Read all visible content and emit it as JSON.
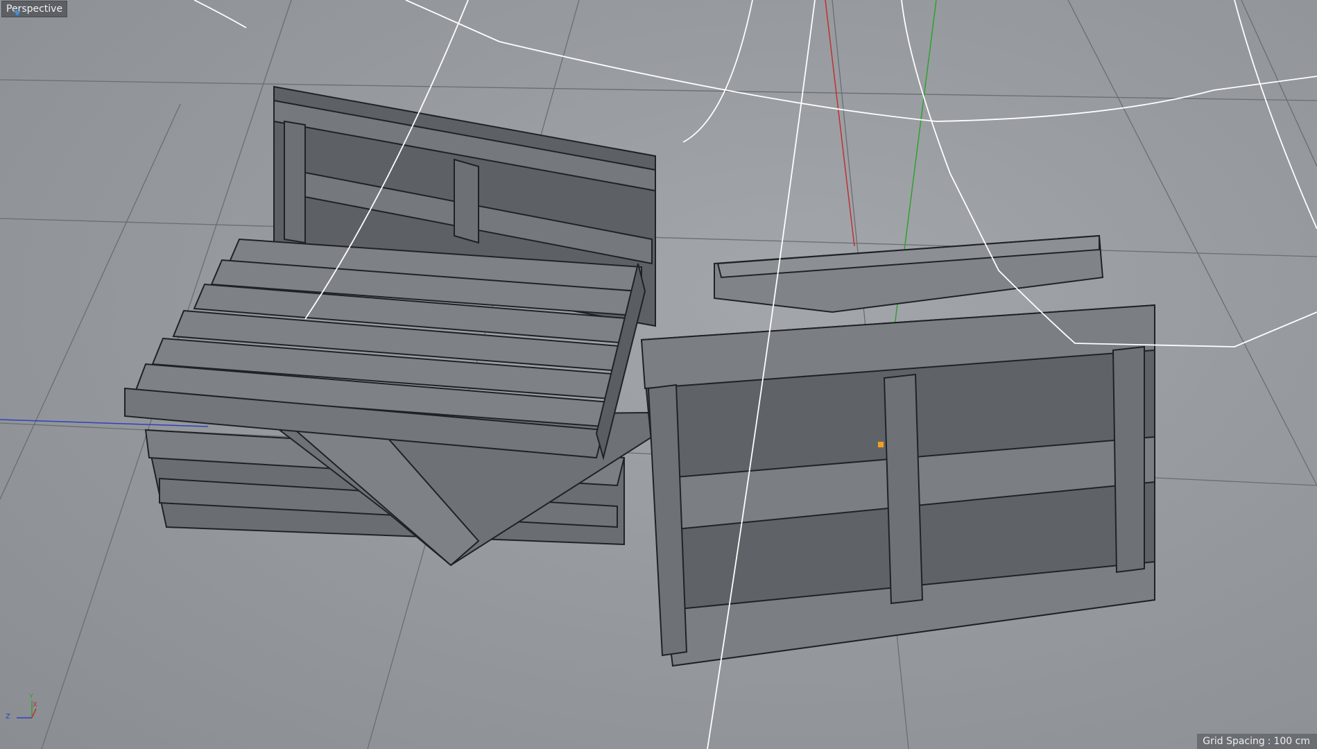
{
  "viewport": {
    "view_name": "Perspective",
    "grid_spacing_label": "Grid Spacing",
    "grid_spacing_value": "100 cm"
  },
  "axis_gizmo": {
    "x_label": "X",
    "y_label": "Y",
    "z_label": "Z"
  },
  "colors": {
    "x_axis": "#c03030",
    "y_axis": "#30a030",
    "z_axis": "#3040c0",
    "spline": "#ffffff",
    "pallet_face": "#6a6e72",
    "pallet_edge": "#1f2225",
    "selection_handle": "#f0a020"
  },
  "icons": {
    "view_marker": "triangle-down-icon",
    "axis_gizmo": "axis-gizmo-icon"
  }
}
